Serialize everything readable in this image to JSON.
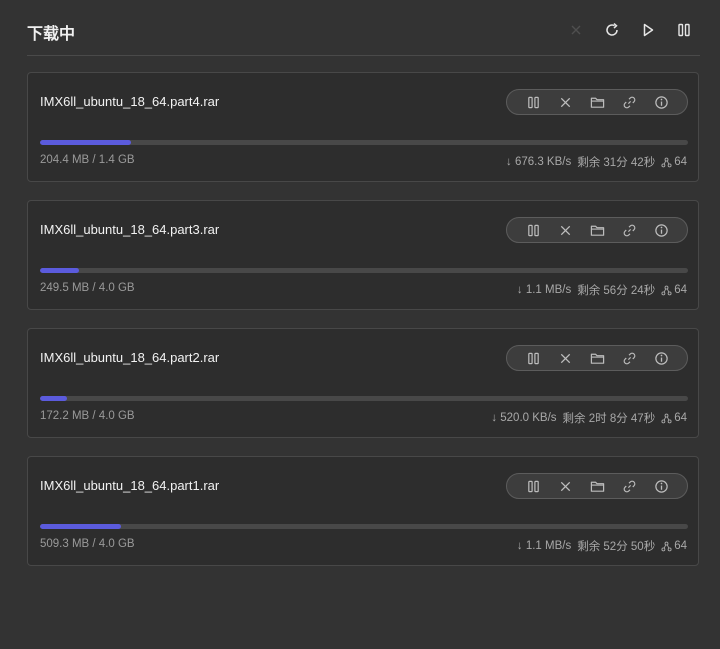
{
  "header": {
    "title": "下载中"
  },
  "tasks": [
    {
      "name": "IMX6ll_ubuntu_18_64.part4.rar",
      "size": "204.4 MB / 1.4 GB",
      "progress": 0.14,
      "speed": "↓ 676.3 KB/s",
      "remaining": "剩余 31分 42秒",
      "connections": "64"
    },
    {
      "name": "IMX6ll_ubuntu_18_64.part3.rar",
      "size": "249.5 MB / 4.0 GB",
      "progress": 0.06,
      "speed": "↓ 1.1 MB/s",
      "remaining": "剩余 56分 24秒",
      "connections": "64"
    },
    {
      "name": "IMX6ll_ubuntu_18_64.part2.rar",
      "size": "172.2 MB / 4.0 GB",
      "progress": 0.042,
      "speed": "↓ 520.0 KB/s",
      "remaining": "剩余 2时 8分 47秒",
      "connections": "64"
    },
    {
      "name": "IMX6ll_ubuntu_18_64.part1.rar",
      "size": "509.3 MB / 4.0 GB",
      "progress": 0.125,
      "speed": "↓ 1.1 MB/s",
      "remaining": "剩余 52分 50秒",
      "connections": "64"
    }
  ],
  "colors": {
    "accent": "#5b5bdd",
    "background": "#333333",
    "card": "#2d2d2d"
  },
  "icons": {
    "header": [
      "close-icon",
      "refresh-icon",
      "play-icon",
      "pause-icon"
    ],
    "task_actions": [
      "pause-icon",
      "close-icon",
      "folder-icon",
      "link-icon",
      "info-icon"
    ]
  }
}
